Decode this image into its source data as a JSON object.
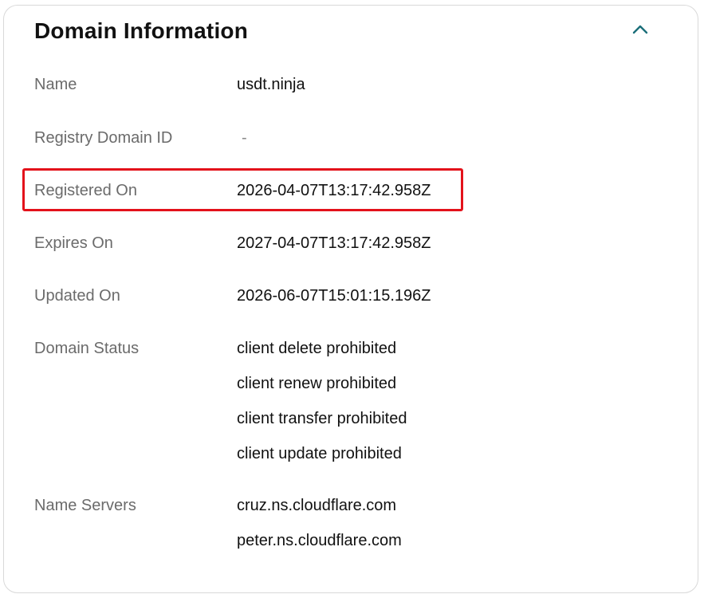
{
  "section": {
    "title": "Domain Information",
    "collapse_icon": "chevron-up-icon"
  },
  "rows": {
    "name": {
      "label": "Name",
      "value": "usdt.ninja"
    },
    "registry_domain_id": {
      "label": "Registry Domain ID",
      "value": "-"
    },
    "registered_on": {
      "label": "Registered On",
      "value": "2026-04-07T13:17:42.958Z"
    },
    "expires_on": {
      "label": "Expires On",
      "value": "2027-04-07T13:17:42.958Z"
    },
    "updated_on": {
      "label": "Updated On",
      "value": "2026-06-07T15:01:15.196Z"
    },
    "domain_status": {
      "label": "Domain Status",
      "values": [
        "client delete prohibited",
        "client renew prohibited",
        "client transfer prohibited",
        "client update prohibited"
      ]
    },
    "name_servers": {
      "label": "Name Servers",
      "values": [
        "cruz.ns.cloudflare.com",
        "peter.ns.cloudflare.com"
      ]
    }
  },
  "colors": {
    "highlight": "#e3121b",
    "accent": "#1b6f7a",
    "label_text": "#6b6b6b",
    "value_text": "#111111"
  }
}
